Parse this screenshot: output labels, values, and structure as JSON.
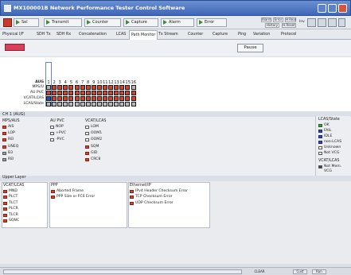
{
  "window": {
    "title": "MX100001B Network Performance Tester Control Software"
  },
  "toolbar": {
    "btn_sel": "Sel",
    "btn_transmit": "Transmit",
    "btn_counter": "Counter",
    "btn_capture": "Capture",
    "btn_alarm": "Alarm",
    "btn_error": "Error",
    "small_top": [
      "Alarm",
      "Error",
      "H Real"
    ],
    "small_bottom": [
      "History",
      "H.Reset"
    ],
    "label_inv": "Inv"
  },
  "tabs": [
    "Physical I/F",
    "SDH Tx",
    "SDH Rx",
    "Concatenation",
    "LCAS",
    "Path Monitor",
    "Tx Stream",
    "Counter",
    "Capture",
    "Ping",
    "Variation",
    "Protocol"
  ],
  "active_tab": "Path Monitor",
  "subbar": {
    "pause_label": "Pause"
  },
  "grid": {
    "header_label": "AUG",
    "columns": [
      "1",
      "2",
      "3",
      "4",
      "5",
      "6",
      "7",
      "8",
      "9",
      "10",
      "11",
      "12",
      "13",
      "14",
      "15",
      "16"
    ],
    "rows": [
      {
        "label": "MPS/U",
        "cells": [
          "g",
          "r",
          "r",
          "r",
          "r",
          "r",
          "r",
          "r",
          "r",
          "r",
          "r",
          "r",
          "r",
          "r",
          "r",
          "g"
        ]
      },
      {
        "label": "AU PVC",
        "cells": [
          "r",
          "r",
          "r",
          "r",
          "r",
          "r",
          "r",
          "r",
          "r",
          "r",
          "r",
          "r",
          "r",
          "r",
          "r",
          "r"
        ]
      },
      {
        "label": "VCAT/LCAS",
        "cells": [
          "b",
          "r",
          "r",
          "r",
          "r",
          "r",
          "r",
          "r",
          "r",
          "r",
          "r",
          "r",
          "r",
          "r",
          "r",
          "r"
        ]
      },
      {
        "label": "LCAS/State",
        "cells": [
          "g",
          "g",
          "g",
          "g",
          "g",
          "g",
          "g",
          "g",
          "g",
          "g",
          "g",
          "g",
          "g",
          "g",
          "g",
          "g"
        ]
      }
    ]
  },
  "ch1": {
    "label": "CH 1 (AUG)",
    "groups": [
      {
        "title": "MPS/AUS",
        "items": [
          {
            "label": "AIS",
            "led": "red"
          },
          {
            "label": "LOP",
            "led": "red"
          },
          {
            "label": "REI",
            "led": "red"
          },
          {
            "label": "UNEQ",
            "led": "red"
          },
          {
            "label": "B3",
            "led": "grey"
          },
          {
            "label": "REI",
            "led": "grey"
          }
        ]
      },
      {
        "title": "AU PVC",
        "items": [
          {
            "label": "NOP",
            "led": "white"
          },
          {
            "label": "+PVC",
            "led": "white"
          },
          {
            "label": "-PVC",
            "led": "white"
          }
        ]
      },
      {
        "title": "VCAT/LCAS",
        "items": [
          {
            "label": "LOM",
            "led": "white"
          },
          {
            "label": "OOM1",
            "led": "white"
          },
          {
            "label": "OOM2",
            "led": "white"
          },
          {
            "label": "SQM",
            "led": "red"
          },
          {
            "label": "GID",
            "led": "red"
          },
          {
            "label": "CRC8",
            "led": "red"
          }
        ]
      }
    ],
    "legend": {
      "title": "LCAS/State",
      "items": [
        {
          "label": "OK",
          "led": "green"
        },
        {
          "label": "FAIL",
          "led": "blue"
        },
        {
          "label": "IDLE",
          "led": "blue"
        },
        {
          "label": "non-LCAS",
          "led": "blue"
        },
        {
          "label": "Unknown",
          "led": "white"
        },
        {
          "label": "Not VCG",
          "led": "white"
        }
      ],
      "title2": "VCAT/LCAS",
      "items2": [
        {
          "label": "Not Mem.",
          "led": "black"
        },
        {
          "label": "VCG",
          "led": "none"
        }
      ]
    }
  },
  "upper": {
    "label": "Upper Layer",
    "groups": [
      {
        "title": "VCAT/LCAS",
        "items": [
          {
            "label": "MND",
            "led": "red"
          },
          {
            "label": "PLCT",
            "led": "red"
          },
          {
            "label": "TLCT",
            "led": "red"
          },
          {
            "label": "PLCR",
            "led": "red"
          },
          {
            "label": "TLCR",
            "led": "red"
          },
          {
            "label": "SQNC",
            "led": "red"
          }
        ]
      },
      {
        "title": "PPP",
        "items": [
          {
            "label": "Aborted Frame",
            "led": "red"
          },
          {
            "label": "PPP Size or FCS Error",
            "led": "red"
          }
        ]
      },
      {
        "title": "Ethernet/IP",
        "items": [
          {
            "label": "IPv4 Header Checksum Error",
            "led": "red"
          },
          {
            "label": "TCP Checksum Error",
            "led": "red"
          },
          {
            "label": "UDP Checksum Error",
            "led": "red"
          }
        ]
      }
    ]
  },
  "status": {
    "text": "CLEAR",
    "btn1": "Cust",
    "btn2": "Run"
  },
  "colors": {
    "red": "#d8402e",
    "grey": "#b4b8bf",
    "blue": "#2a48a8",
    "titlebar": "#3f66b8"
  }
}
